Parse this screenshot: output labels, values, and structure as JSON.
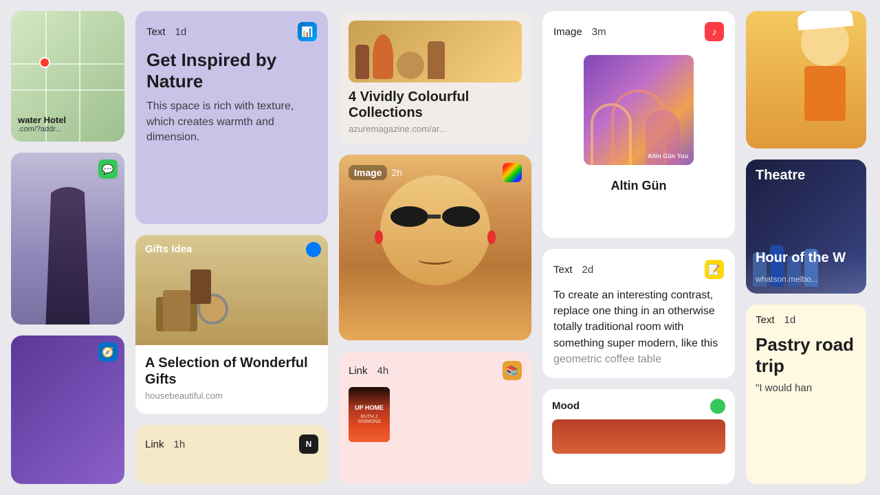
{
  "cards": {
    "map": {
      "label": "water Hotel",
      "sub": ".com/?addr..."
    },
    "text_nature": {
      "type": "Text",
      "time": "1d",
      "title": "Get Inspired by Nature",
      "body": "This space is rich with texture, which creates warmth and dimension.",
      "app_icon": "keynote"
    },
    "gifts": {
      "label": "Gifts Idea",
      "title": "A Selection of Wonderful Gifts",
      "url": "housebeautiful.com"
    },
    "link_bottom": {
      "type": "Link",
      "time": "1h",
      "app_icon": "notion"
    },
    "colourful": {
      "title": "4 Vividly Colourful Collections",
      "url": "azuremagazine.com/ar..."
    },
    "image_person": {
      "type": "Image",
      "time": "2h",
      "app_icon": "photos"
    },
    "book_link": {
      "type": "Link",
      "time": "4h",
      "app_icon": "books",
      "book_title": "UP HOME",
      "book_author": "RUTH J SIMMONS"
    },
    "music": {
      "type": "Image",
      "time": "3m",
      "app_icon": "music",
      "artist": "Altin Gün",
      "album": "Altin Gün You"
    },
    "text_contrast": {
      "type": "Text",
      "time": "2d",
      "body_visible": "To create an interesting contrast, replace one thing in an otherwise totally traditional room with something super modern, like this",
      "body_fade": "geometric coffee table",
      "app_icon": "notes"
    },
    "mood": {
      "label": "Mood",
      "app_icon": "green_dot"
    },
    "theatre": {
      "label": "Theatre",
      "title": "Hour of the W",
      "url": "whatson.melbo..."
    },
    "pastry": {
      "type": "Text",
      "time": "1d",
      "title": "Pastry road trip",
      "body": "\"I would han"
    }
  },
  "icons": {
    "keynote": "📊",
    "photos": "🌈",
    "music": "🎵",
    "notes": "📝",
    "notion": "N",
    "books": "📚",
    "safari": "🧭",
    "messages": "💬"
  }
}
